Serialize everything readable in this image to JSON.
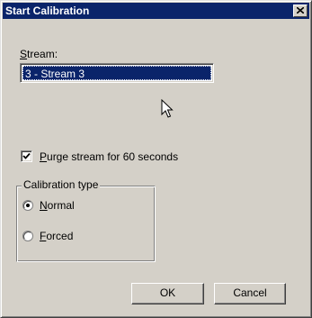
{
  "window": {
    "title": "Start Calibration",
    "close_icon": "close-icon"
  },
  "stream": {
    "label_mnemonic": "S",
    "label_rest": "tream:",
    "selected_value": "3 - Stream 3"
  },
  "purge": {
    "checked": true,
    "label_mnemonic": "P",
    "label_rest": "urge stream for 60 seconds"
  },
  "calibration_type": {
    "title": "Calibration type",
    "options": [
      {
        "mnemonic": "N",
        "rest": "ormal",
        "selected": true
      },
      {
        "mnemonic": "F",
        "rest": "orced",
        "selected": false
      }
    ]
  },
  "buttons": {
    "ok_label": "OK",
    "cancel_label": "Cancel"
  },
  "colors": {
    "face": "#d4d0c8",
    "title_bar": "#0a246a",
    "selection": "#0a246a"
  }
}
